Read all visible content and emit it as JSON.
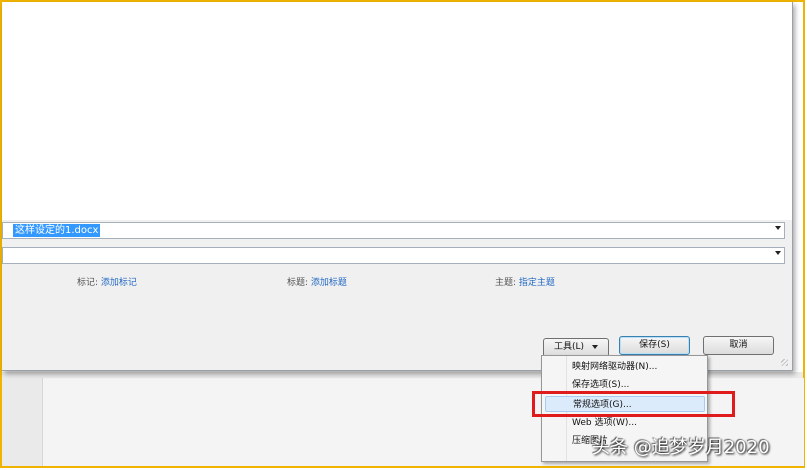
{
  "file_name": {
    "value": "这样设定的1.docx"
  },
  "meta": {
    "tags_label": "标记:",
    "tags_link": "添加标记",
    "title_label": "标题:",
    "title_link": "添加标题",
    "subject_label": "主题:",
    "subject_link": "指定主题"
  },
  "buttons": {
    "tools": "工具(L)",
    "save": "保存(S)",
    "cancel": "取消"
  },
  "tools_menu": {
    "items": [
      "映射网络驱动器(N)...",
      "保存选项(S)...",
      "常规选项(G)...",
      "Web 选项(W)...",
      "压缩图片"
    ]
  },
  "watermark": "头条 @追梦岁月2020",
  "colors": {
    "frame": "#f0b400",
    "highlight_box": "#e01b1b",
    "selection": "#3399ff",
    "link": "#2369c3"
  }
}
